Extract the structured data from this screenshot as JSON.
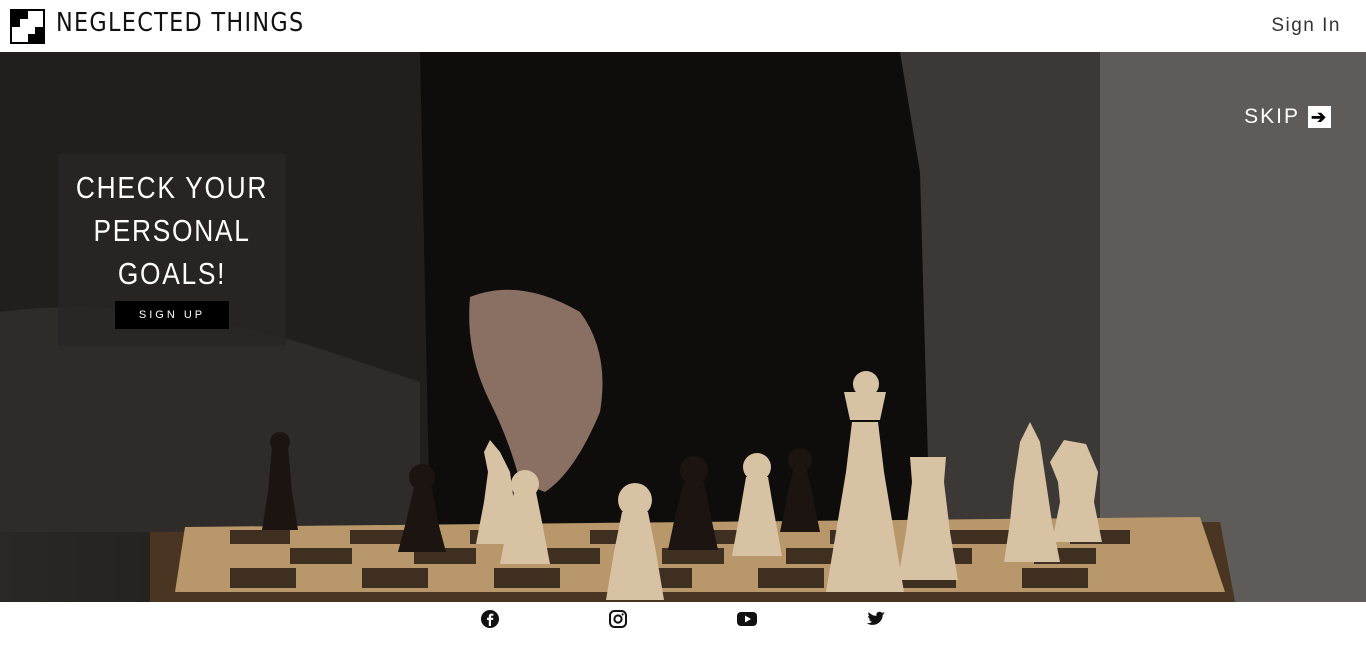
{
  "header": {
    "brand": "NEGLECTED THINGS",
    "signin_label": "Sign In"
  },
  "hero": {
    "skip_label": "SKIP",
    "cta": {
      "title_line1": "CHECK YOUR",
      "title_line2": "PERSONAL",
      "title_line3": "GOALS!",
      "signup_label": "SIGN UP"
    }
  },
  "footer": {
    "social": [
      "facebook-icon",
      "instagram-icon",
      "youtube-icon",
      "twitter-icon"
    ]
  }
}
